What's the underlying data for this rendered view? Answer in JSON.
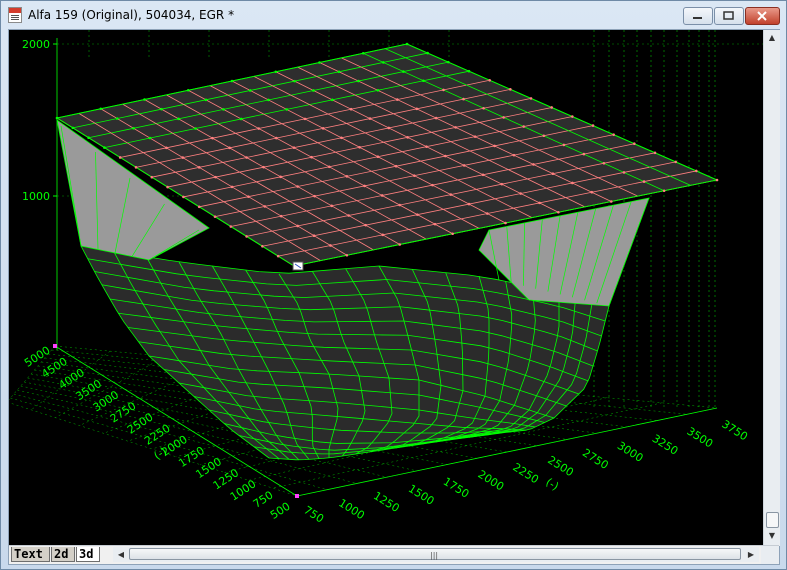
{
  "window": {
    "title": "Alfa 159 (Original), 504034, EGR *",
    "controls": {
      "minimize_icon": "minimize-icon",
      "maximize_icon": "maximize-icon",
      "close_icon": "close-icon"
    }
  },
  "plot": {
    "background": "#000000",
    "grid_color": "#00ff00",
    "axis_text_color": "#00ff00",
    "z_ticks": [
      "2000",
      "1000"
    ],
    "y_ticks": [
      "5000",
      "4500",
      "4000",
      "3500",
      "3000",
      "2750",
      "2500",
      "2250",
      "2000",
      "1750",
      "1500",
      "1250",
      "1000",
      "750",
      "500"
    ],
    "y_unit": "(-)",
    "x_ticks": [
      "750",
      "1000",
      "1250",
      "1500",
      "1750",
      "2000",
      "2250",
      "2500",
      "2750",
      "3000",
      "3250",
      "3500",
      "3750"
    ],
    "x_unit": "(-)",
    "surface_color_top": "#ff8080",
    "surface_color": "#00ff00"
  },
  "tabs": [
    {
      "label": "Text",
      "active": false
    },
    {
      "label": "2d",
      "active": false
    },
    {
      "label": "3d",
      "active": true
    }
  ],
  "scrollbar": {
    "left_arrow": "◀",
    "right_arrow": "▶",
    "up_arrow": "▲",
    "down_arrow": "▼",
    "grip": "|||"
  }
}
